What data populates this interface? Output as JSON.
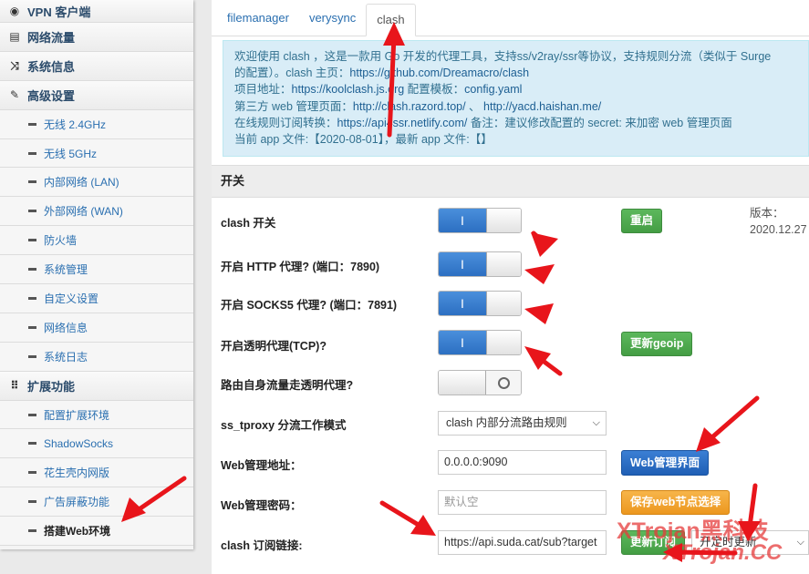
{
  "sidebar": {
    "items": [
      {
        "label": "VPN 客户端",
        "type": "top",
        "icon": "globe-icon",
        "glyph": "◉"
      },
      {
        "label": "网络流量",
        "type": "top",
        "icon": "bars-icon",
        "glyph": "▤"
      },
      {
        "label": "系统信息",
        "type": "top",
        "icon": "shuffle-icon",
        "glyph": "⤨"
      },
      {
        "label": "高级设置",
        "type": "top",
        "icon": "wrench-icon",
        "glyph": "✎"
      },
      {
        "label": "无线 2.4GHz",
        "type": "sub"
      },
      {
        "label": "无线 5GHz",
        "type": "sub"
      },
      {
        "label": "内部网络 (LAN)",
        "type": "sub"
      },
      {
        "label": "外部网络 (WAN)",
        "type": "sub"
      },
      {
        "label": "防火墙",
        "type": "sub"
      },
      {
        "label": "系统管理",
        "type": "sub"
      },
      {
        "label": "自定义设置",
        "type": "sub"
      },
      {
        "label": "网络信息",
        "type": "sub"
      },
      {
        "label": "系统日志",
        "type": "sub"
      },
      {
        "label": "扩展功能",
        "type": "top",
        "icon": "grid-icon",
        "glyph": "⠿"
      },
      {
        "label": "配置扩展环境",
        "type": "sub"
      },
      {
        "label": "ShadowSocks",
        "type": "sub"
      },
      {
        "label": "花生壳内网版",
        "type": "sub"
      },
      {
        "label": "广告屏蔽功能",
        "type": "sub"
      },
      {
        "label": "搭建Web环境",
        "type": "sub",
        "active": true
      }
    ]
  },
  "tabs": [
    "filemanager",
    "verysync",
    "clash"
  ],
  "active_tab": "clash",
  "info": {
    "line1a": "欢迎使用 clash ，这是一款用 Go 开发的代理工具，支持ss/v2ray/ssr等协议，支持规则分流（类似于 Surge",
    "line1b": "的配置）。clash 主页：",
    "home_link": "https://github.com/Dreamacro/clash",
    "line2a": "项目地址：",
    "project_link": "https://koolclash.js.org",
    "line2b": " 配置模板：",
    "template_link": "config.yaml",
    "line3a": "第三方 web 管理页面：",
    "web1": "http://clash.razord.top/",
    "sep": " 、 ",
    "web2": "http://yacd.haishan.me/",
    "line4a": "在线规则订阅转换：",
    "sub_link": "https://api4ssr.netlify.com/",
    "line4b": " 备注：建议修改配置的 secret: 来加密 web 管理页面",
    "line5": "当前 app 文件:【2020-08-01】，最新 app 文件:【】"
  },
  "section_title": "开关",
  "rows": {
    "clash_switch": "clash 开关",
    "http_proxy": "开启 HTTP 代理? (端口：7890)",
    "socks5_proxy": "开启 SOCKS5 代理? (端口：7891)",
    "tcp_proxy": "开启透明代理(TCP)?",
    "route_self": "路由自身流量走透明代理?",
    "tproxy_mode": "ss_tproxy 分流工作模式",
    "web_addr": "Web管理地址：",
    "web_pass": "Web管理密码：",
    "sub_link": "clash 订阅链接:"
  },
  "toggle_on_glyph": "I",
  "buttons": {
    "restart": "重启",
    "update_geoip": "更新geoip",
    "web_ui": "Web管理界面",
    "save_nodes": "保存web节点选择",
    "update_sub": "更新订阅"
  },
  "version_label": "版本：",
  "version_value": "2020.12.27",
  "tproxy_mode_value": "clash 内部分流路由规则",
  "web_addr_value": "0.0.0.0:9090",
  "web_pass_placeholder": "默认空",
  "sub_link_value": "https://api.suda.cat/sub?target",
  "schedule_value": "开定时更新",
  "watermark": {
    "line1": "XTrojan黑科技",
    "line2": "XTrojan.CC"
  },
  "colors": {
    "link": "#2a6fb0",
    "info_bg": "#d9edf7",
    "toggle_on": "#2c6fc2",
    "arrow": "#e8151b"
  }
}
